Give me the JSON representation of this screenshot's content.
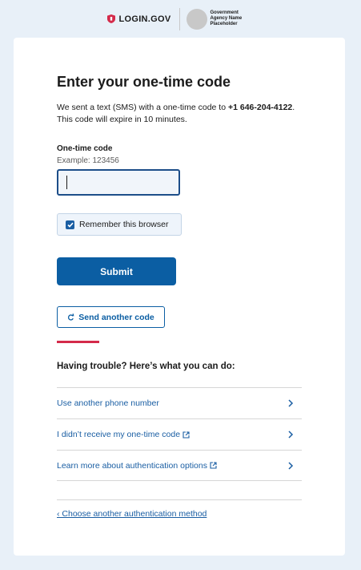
{
  "header": {
    "brand": "LOGIN.GOV",
    "agency_name": "Government Agency Name Placeholder"
  },
  "main": {
    "title": "Enter your one-time code",
    "intro_prefix": "We sent a text (SMS) with a one-time code to ",
    "phone": "+1 646-204-4122",
    "intro_suffix": ". This code will expire in 10 minutes.",
    "field_label": "One-time code",
    "field_hint": "Example: 123456",
    "field_value": "",
    "remember_label": "Remember this browser",
    "remember_checked": true,
    "submit_label": "Submit",
    "resend_label": "Send another code"
  },
  "trouble": {
    "title": "Having trouble? Here’s what you can do:",
    "options": [
      {
        "label": "Use another phone number",
        "external": false
      },
      {
        "label": "I didn’t receive my one-time code",
        "external": true
      },
      {
        "label": "Learn more about authentication options",
        "external": true
      }
    ]
  },
  "footer_link": "‹ Choose another authentication method",
  "colors": {
    "accent": "#0b5ea3",
    "link": "#1a5ea3",
    "alert_rule": "#d42a4a",
    "page_bg": "#e8f0f8"
  }
}
